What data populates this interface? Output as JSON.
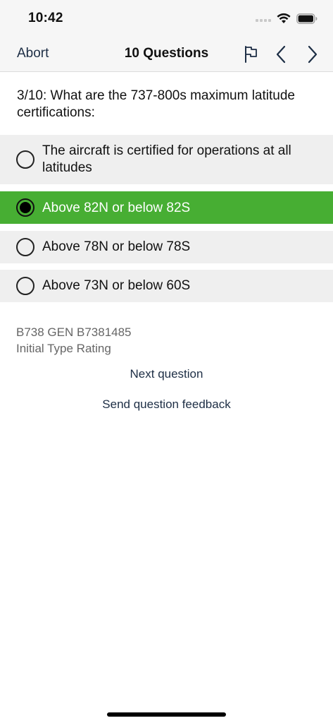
{
  "status_bar": {
    "time": "10:42"
  },
  "nav": {
    "abort_label": "Abort",
    "title": "10 Questions"
  },
  "question": {
    "text": "3/10: What are the 737-800s maximum latitude certifications:"
  },
  "answers": [
    {
      "label": "The aircraft is certified for operations at all latitudes",
      "selected": false
    },
    {
      "label": "Above 82N or below 82S",
      "selected": true
    },
    {
      "label": "Above 78N or below 78S",
      "selected": false
    },
    {
      "label": "Above 73N or below 60S",
      "selected": false
    }
  ],
  "meta": {
    "code": "B738 GEN B7381485",
    "rating": "Initial Type Rating"
  },
  "actions": {
    "next_question": "Next question",
    "send_feedback": "Send question feedback"
  },
  "colors": {
    "selected_answer": "#47ae33",
    "answer_background": "#efefef",
    "link_text": "#1d2e45"
  }
}
